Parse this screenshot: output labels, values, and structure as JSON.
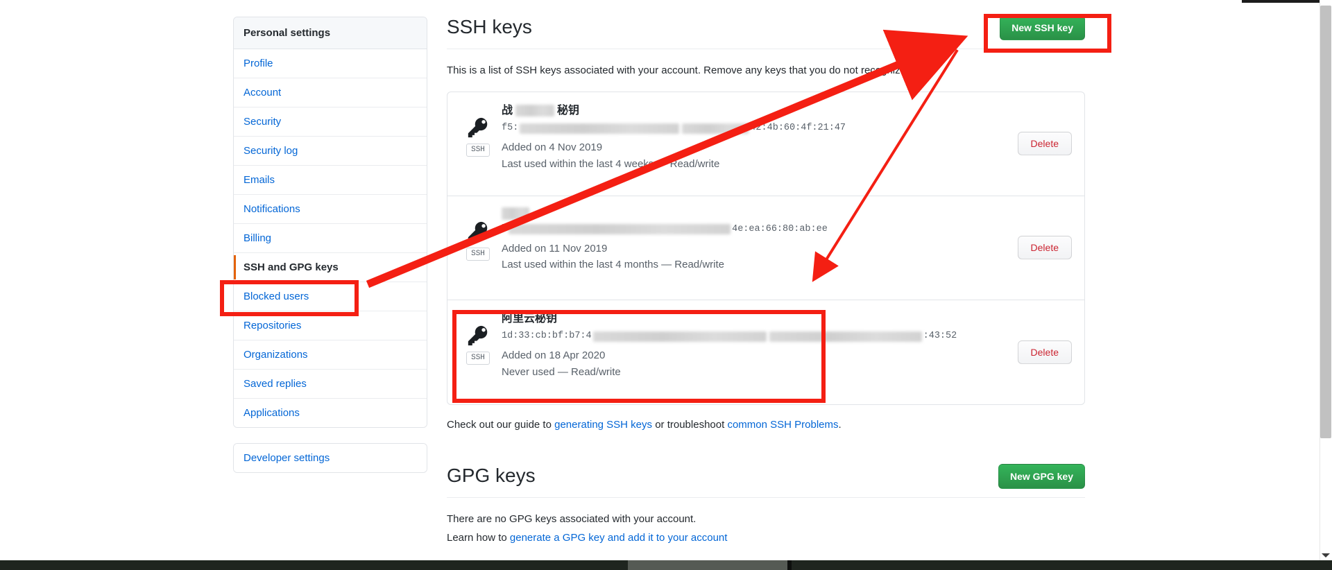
{
  "sidebar": {
    "header": "Personal settings",
    "items": [
      {
        "label": "Profile",
        "selected": false
      },
      {
        "label": "Account",
        "selected": false
      },
      {
        "label": "Security",
        "selected": false
      },
      {
        "label": "Security log",
        "selected": false
      },
      {
        "label": "Emails",
        "selected": false
      },
      {
        "label": "Notifications",
        "selected": false
      },
      {
        "label": "Billing",
        "selected": false
      },
      {
        "label": "SSH and GPG keys",
        "selected": true
      },
      {
        "label": "Blocked users",
        "selected": false
      },
      {
        "label": "Repositories",
        "selected": false
      },
      {
        "label": "Organizations",
        "selected": false
      },
      {
        "label": "Saved replies",
        "selected": false
      },
      {
        "label": "Applications",
        "selected": false
      }
    ],
    "developer_settings": "Developer settings"
  },
  "ssh_section": {
    "title": "SSH keys",
    "new_key_button": "New SSH key",
    "description": "This is a list of SSH keys associated with your account. Remove any keys that you do not recognize.",
    "badge_label": "SSH",
    "delete_label": "Delete",
    "keys": [
      {
        "title_prefix": "战",
        "title_suffix": "秘钥",
        "fingerprint_prefix": "f5:",
        "fingerprint_suffix": "42:4b:60:4f:21:47",
        "added": "Added on 4 Nov 2019",
        "usage": "Last used within the last 4 weeks — Read/write"
      },
      {
        "title_prefix": "",
        "title_suffix": "",
        "fingerprint_prefix": "b",
        "fingerprint_suffix": "4e:ea:66:80:ab:ee",
        "added": "Added on 11 Nov 2019",
        "usage": "Last used within the last 4 months — Read/write"
      },
      {
        "title_prefix": "阿里云秘钥",
        "title_suffix": "",
        "fingerprint_prefix": "1d:33:cb:bf:b7:4",
        "fingerprint_suffix": ":43:52",
        "added": "Added on 18 Apr 2020",
        "usage": "Never used — Read/write"
      }
    ],
    "footnote": {
      "lead": "Check out our guide to ",
      "link1": "generating SSH keys",
      "middle": " or troubleshoot ",
      "link2": "common SSH Problems",
      "tail": "."
    }
  },
  "gpg_section": {
    "title": "GPG keys",
    "new_key_button": "New GPG key",
    "empty_text": "There are no GPG keys associated with your account.",
    "learn_lead": "Learn how to ",
    "learn_link": "generate a GPG key and add it to your account"
  },
  "annotations": {
    "color": "#f41f13",
    "boxes": [
      "new-ssh-key-button",
      "sidebar-ssh-and-gpg-keys",
      "third-ssh-key-entry"
    ],
    "arrows": [
      "sidebar-to-new-ssh-key-button",
      "new-ssh-key-button-to-third-key-entry"
    ]
  }
}
